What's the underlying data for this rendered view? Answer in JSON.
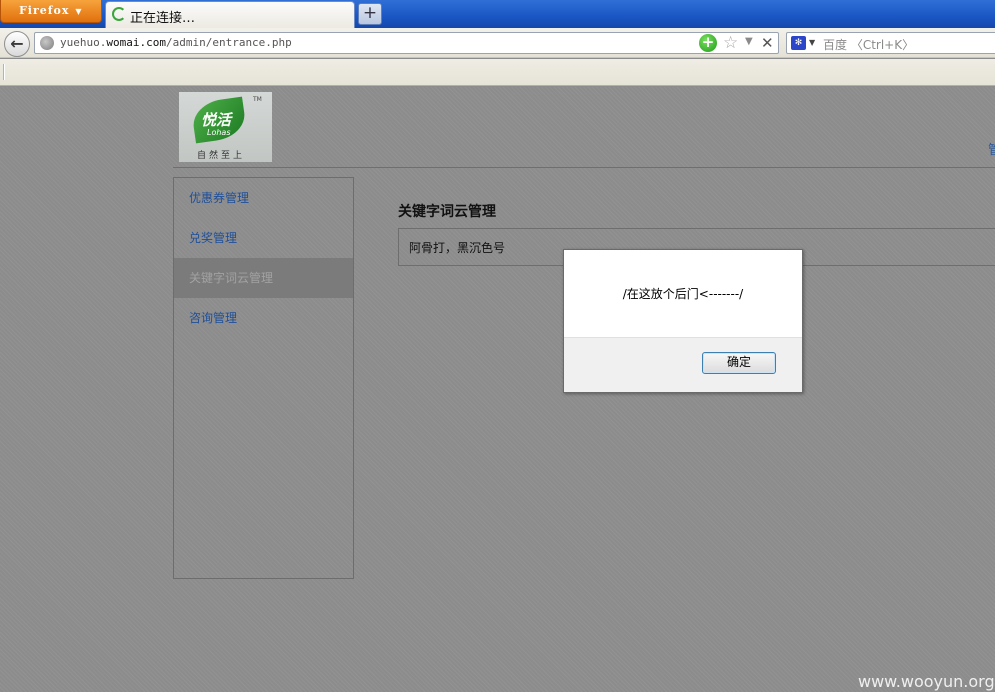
{
  "browser": {
    "menu_button_label": "Firefox",
    "menu_button_caret": "▼",
    "tab_title": "正在连接…",
    "new_tab_label": "+",
    "url_prefix": "yuehuo.",
    "url_domain": "womai.com",
    "url_path": "/admin/entrance.php",
    "search_placeholder": "百度 〈Ctrl+K〉"
  },
  "header": {
    "logo_brand": "悦活",
    "logo_sub": "Lohas",
    "logo_slogan": "自然至上",
    "logo_tm": "TM",
    "top_right_link": "管"
  },
  "sidebar": {
    "items": [
      {
        "label": "优惠券管理"
      },
      {
        "label": "兑奖管理"
      },
      {
        "label": "关键字词云管理"
      },
      {
        "label": "咨询管理"
      }
    ]
  },
  "main": {
    "section_title": "关键字词云管理",
    "keywords_text": "阿骨打，黑沉色号"
  },
  "alert": {
    "message": "/在这放个后门<-------/",
    "ok_label": "确定"
  },
  "watermark": "www.wooyun.org"
}
